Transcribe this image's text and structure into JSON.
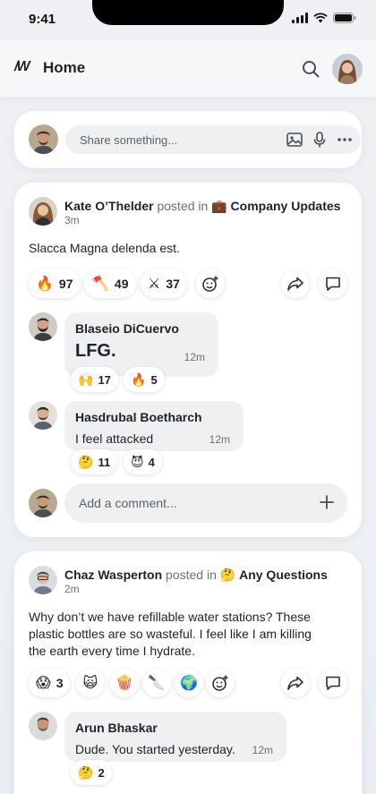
{
  "status": {
    "time": "9:41"
  },
  "header": {
    "logo": "/W",
    "title": "Home"
  },
  "composer": {
    "placeholder": "Share something..."
  },
  "posts": [
    {
      "author": "Kate O’Thelder",
      "posted_in": "posted in",
      "channel": "Company Updates",
      "channel_icon": "💼",
      "time": "3m",
      "body": "Slacca Magna delenda est.",
      "reactions": [
        {
          "emoji": "🔥",
          "count": "97"
        },
        {
          "emoji": "🪓",
          "count": "49"
        },
        {
          "emoji": "⚔",
          "count": "37"
        }
      ],
      "comments": [
        {
          "author": "Blaseio DiCuervo",
          "text": "LFG.",
          "time": "12m",
          "reactions": [
            {
              "emoji": "🙌",
              "count": "17"
            },
            {
              "emoji": "🔥",
              "count": "5"
            }
          ]
        },
        {
          "author": "Hasdrubal Boetharch",
          "text": "I feel attacked",
          "time": "12m",
          "reactions": [
            {
              "emoji": "🤔",
              "count": "11"
            },
            {
              "emoji": "😈",
              "count": "4"
            }
          ]
        }
      ],
      "comment_placeholder": "Add a comment..."
    },
    {
      "author": "Chaz Wasperton",
      "posted_in": "posted in",
      "channel": "Any Questions",
      "channel_icon": "🤔",
      "time": "2m",
      "body_lines": [
        "Why don’t we have refillable water stations? These",
        "plastic bottles are so wasteful. I feel like I am killing",
        "the earth every time I hydrate."
      ],
      "reactions": [
        {
          "emoji": "😱",
          "count": "3"
        },
        {
          "emoji": "🙀",
          "count": ""
        },
        {
          "emoji": "🍿",
          "count": ""
        },
        {
          "emoji": "🔪",
          "count": ""
        },
        {
          "emoji": "🌍",
          "count": ""
        }
      ],
      "comments": [
        {
          "author": "Arun Bhaskar",
          "text": "Dude. You started yesterday.",
          "time": "12m",
          "reactions": [
            {
              "emoji": "🤔",
              "count": "2"
            }
          ]
        }
      ]
    }
  ],
  "colors": {
    "background": "#eef0f3",
    "card": "#ffffff",
    "input": "#eef0f2",
    "text": "#1f2226",
    "muted": "#6b6f76"
  }
}
